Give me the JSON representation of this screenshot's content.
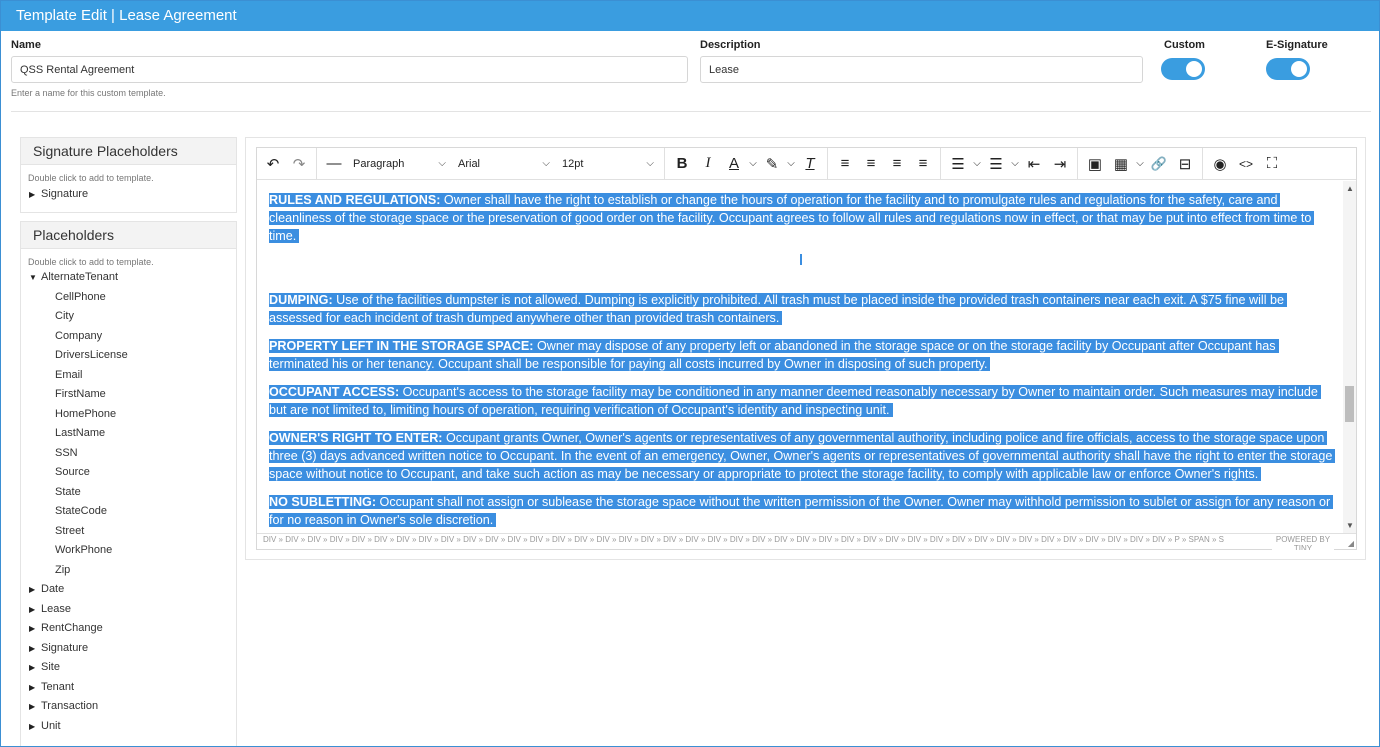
{
  "window": {
    "title": "Template Edit | Lease Agreement"
  },
  "form": {
    "name_label": "Name",
    "name_value": "QSS Rental Agreement",
    "name_hint": "Enter a name for this custom template.",
    "description_label": "Description",
    "description_value": "Lease",
    "custom_label": "Custom",
    "custom_on": true,
    "esignature_label": "E-Signature",
    "esignature_on": true
  },
  "signature_panel": {
    "title": "Signature Placeholders",
    "hint": "Double click to add to template.",
    "items": [
      "Signature"
    ]
  },
  "placeholders_panel": {
    "title": "Placeholders",
    "hint": "Double click to add to template.",
    "expanded_group": "AlternateTenant",
    "expanded_children": [
      "CellPhone",
      "City",
      "Company",
      "DriversLicense",
      "Email",
      "FirstName",
      "HomePhone",
      "LastName",
      "SSN",
      "Source",
      "State",
      "StateCode",
      "Street",
      "WorkPhone",
      "Zip"
    ],
    "groups": [
      "Date",
      "Lease",
      "RentChange",
      "Signature",
      "Site",
      "Tenant",
      "Transaction",
      "Unit"
    ]
  },
  "toolbar": {
    "block_format": "Paragraph",
    "font_family": "Arial",
    "font_size": "12pt",
    "icons": {
      "undo": "↶",
      "redo": "↷",
      "hr": "—",
      "bold": "B",
      "italic": "I",
      "text_color": "A",
      "highlight": "✎",
      "clear_format": "T",
      "align_left": "≡",
      "align_center": "≡",
      "align_right": "≡",
      "justify": "≡",
      "bullet_list": "☰",
      "numbered_list": "☰",
      "outdent": "⇤",
      "indent": "⇥",
      "image": "▣",
      "table": "▦",
      "link": "🔗",
      "page_break": "⊟",
      "preview": "◉",
      "code": "<>",
      "fullscreen": "⛶",
      "dropdown": "⌵"
    }
  },
  "document": {
    "paragraphs": [
      {
        "heading": "RULES AND REGULATIONS:",
        "text": " Owner shall have the right to establish or change the hours of operation for the facility and to promulgate rules and regulations for the safety, care and cleanliness of the storage space or the preservation of good order on the facility. Occupant agrees to follow all rules and regulations now in effect, or that may be put into effect from time to time."
      },
      {
        "heading": "DUMPING:",
        "text": " Use of the facilities dumpster is not allowed. Dumping is explicitly prohibited. All trash must be placed inside the provided trash containers near each exit. A $75 fine will be assessed for each incident of trash dumped anywhere other than provided trash containers."
      },
      {
        "heading": "PROPERTY LEFT IN THE STORAGE SPACE:",
        "text": " Owner may dispose of any property left or abandoned in the storage space or on the storage facility by Occupant after Occupant has terminated his or her tenancy. Occupant shall be responsible for paying all costs incurred by Owner in disposing of such property."
      },
      {
        "heading": "OCCUPANT ACCESS:",
        "text": " Occupant's access to the storage facility may be conditioned in any manner deemed reasonably necessary by Owner to maintain order. Such measures may include but are not limited to, limiting hours of operation, requiring verification of Occupant's identity and inspecting unit."
      },
      {
        "heading": "OWNER'S RIGHT TO ENTER:",
        "text": " Occupant grants Owner, Owner's agents or representatives of any governmental authority, including police and fire officials, access to the storage space upon three (3) days advanced written notice to Occupant. In the event of an emergency, Owner, Owner's agents or representatives of governmental authority shall have the right to enter the storage space without notice to Occupant, and take such action as may be necessary or appropriate to protect the storage facility, to comply with applicable law or enforce Owner's rights."
      },
      {
        "heading": "NO SUBLETTING:",
        "text": " Occupant shall not assign or sublease the storage space without the written permission of the Owner. Owner may withhold permission to sublet or assign for any reason or for no reason in Owner's sole discretion."
      }
    ]
  },
  "statusbar": {
    "path": "DIV » DIV » DIV » DIV » DIV » DIV » DIV » DIV » DIV » DIV » DIV » DIV » DIV » DIV » DIV » DIV » DIV » DIV » DIV » DIV » DIV » DIV » DIV » DIV » DIV » DIV » DIV » DIV » DIV » DIV » DIV » DIV » DIV » DIV » DIV » DIV » DIV » DIV » DIV » DIV » DIV » P » SPAN » S",
    "powered": "POWERED BY TINY"
  }
}
